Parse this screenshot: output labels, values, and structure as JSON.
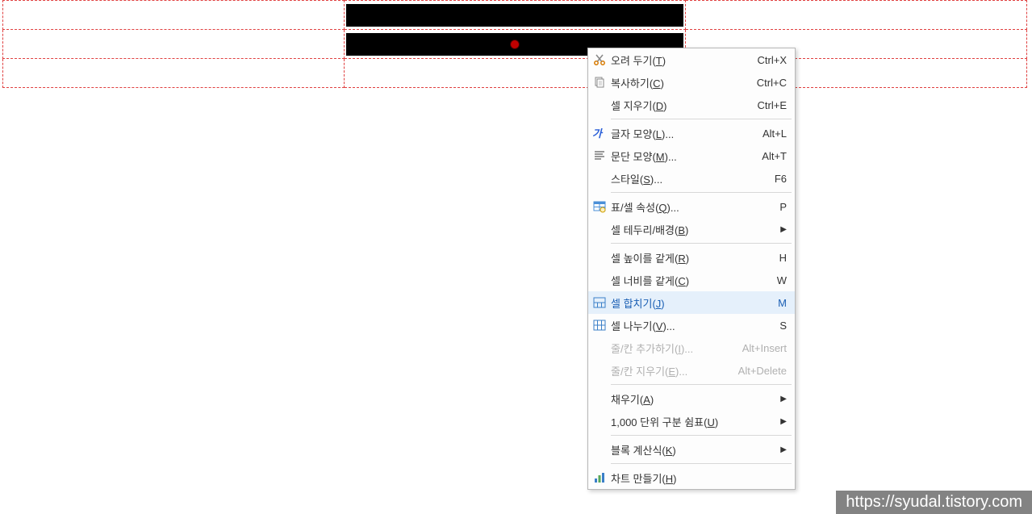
{
  "menu": {
    "items": [
      {
        "label_pre": "오려 두기(",
        "hotkey": "T",
        "label_post": ")",
        "shortcut": "Ctrl+X",
        "icon": "cut"
      },
      {
        "label_pre": "복사하기(",
        "hotkey": "C",
        "label_post": ")",
        "shortcut": "Ctrl+C",
        "icon": "copy"
      },
      {
        "label_pre": "셀 지우기(",
        "hotkey": "D",
        "label_post": ")",
        "shortcut": "Ctrl+E",
        "icon": ""
      },
      {
        "sep": true
      },
      {
        "label_pre": "글자 모양(",
        "hotkey": "L",
        "label_post": ")...",
        "shortcut": "Alt+L",
        "icon": "font"
      },
      {
        "label_pre": "문단 모양(",
        "hotkey": "M",
        "label_post": ")...",
        "shortcut": "Alt+T",
        "icon": "para"
      },
      {
        "label_pre": "스타일(",
        "hotkey": "S",
        "label_post": ")...",
        "shortcut": "F6",
        "icon": ""
      },
      {
        "sep": true
      },
      {
        "label_pre": "표/셀 속성(",
        "hotkey": "Q",
        "label_post": ")...",
        "shortcut": "P",
        "icon": "tableprops"
      },
      {
        "label_pre": "셀 테두리/배경(",
        "hotkey": "B",
        "label_post": ")",
        "submenu": true,
        "icon": ""
      },
      {
        "sep": true
      },
      {
        "label_pre": "셀 높이를 같게(",
        "hotkey": "R",
        "label_post": ")",
        "shortcut": "H",
        "icon": ""
      },
      {
        "label_pre": "셀 너비를 같게(",
        "hotkey": "C",
        "label_post": ")",
        "shortcut": "W",
        "icon": ""
      },
      {
        "label_pre": "셀 합치기(",
        "hotkey": "J",
        "label_post": ")",
        "shortcut": "M",
        "icon": "merge",
        "highlighted": true
      },
      {
        "label_pre": "셀 나누기(",
        "hotkey": "V",
        "label_post": ")...",
        "shortcut": "S",
        "icon": "split"
      },
      {
        "label_pre": "줄/칸 추가하기(",
        "hotkey": "I",
        "label_post": ")...",
        "shortcut": "Alt+Insert",
        "icon": "",
        "disabled": true
      },
      {
        "label_pre": "줄/칸 지우기(",
        "hotkey": "E",
        "label_post": ")...",
        "shortcut": "Alt+Delete",
        "icon": "",
        "disabled": true
      },
      {
        "sep": true
      },
      {
        "label_pre": "채우기(",
        "hotkey": "A",
        "label_post": ")",
        "submenu": true,
        "icon": ""
      },
      {
        "label_pre": "1,000 단위 구분 쉼표(",
        "hotkey": "U",
        "label_post": ")",
        "submenu": true,
        "icon": ""
      },
      {
        "sep": true
      },
      {
        "label_pre": "블록 계산식(",
        "hotkey": "K",
        "label_post": ")",
        "submenu": true,
        "icon": ""
      },
      {
        "sep": true
      },
      {
        "label_pre": "차트 만들기(",
        "hotkey": "H",
        "label_post": ")",
        "icon": "chart"
      }
    ]
  },
  "watermark": "https://syudal.tistory.com"
}
